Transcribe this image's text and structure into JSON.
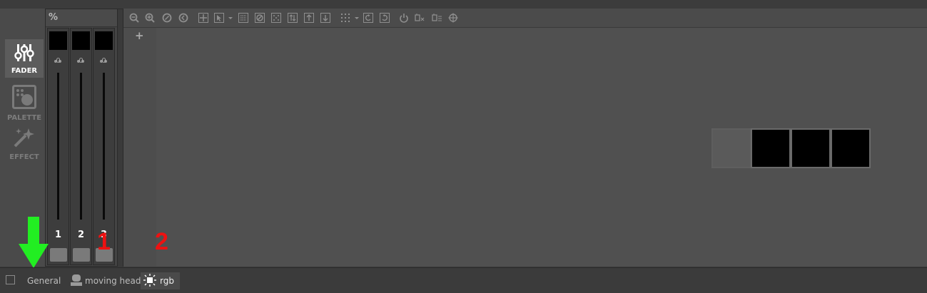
{
  "sidebar": {
    "modes": [
      {
        "label": "FADER",
        "active": true,
        "icon": "sliders-icon"
      },
      {
        "label": "PALETTE",
        "active": false,
        "icon": "palette-icon"
      },
      {
        "label": "EFFECT",
        "active": false,
        "icon": "magic-wand-icon"
      }
    ]
  },
  "fader_panel": {
    "header": "%",
    "channels": [
      {
        "number": "1",
        "value": "0"
      },
      {
        "number": "2",
        "value": "0"
      },
      {
        "number": "3",
        "value": "0"
      }
    ]
  },
  "main": {
    "toolbar_icons": [
      "zoom-out-icon",
      "zoom-in-icon",
      "zoom-reset-icon",
      "back-icon",
      "move-icon",
      "pointer-icon",
      "grid-select-icon",
      "no-select-icon",
      "dots-icon",
      "swap-icon",
      "align-up-icon",
      "align-down-icon",
      "grid-icon",
      "undo-icon",
      "redo-icon",
      "power-icon",
      "clear-icon",
      "fan-icon",
      "target-icon"
    ],
    "add_label": "+"
  },
  "annotations": {
    "one": "1",
    "two": "2"
  },
  "bottom_tabs": [
    {
      "label": "General",
      "icon": "",
      "active": false
    },
    {
      "label": "moving head",
      "icon": "moving-head-icon",
      "active": false
    },
    {
      "label": "rgb",
      "icon": "rgb-light-icon",
      "active": true
    }
  ],
  "colors": {
    "accent_arrow": "#22ee22",
    "annotation": "#ee1111"
  }
}
